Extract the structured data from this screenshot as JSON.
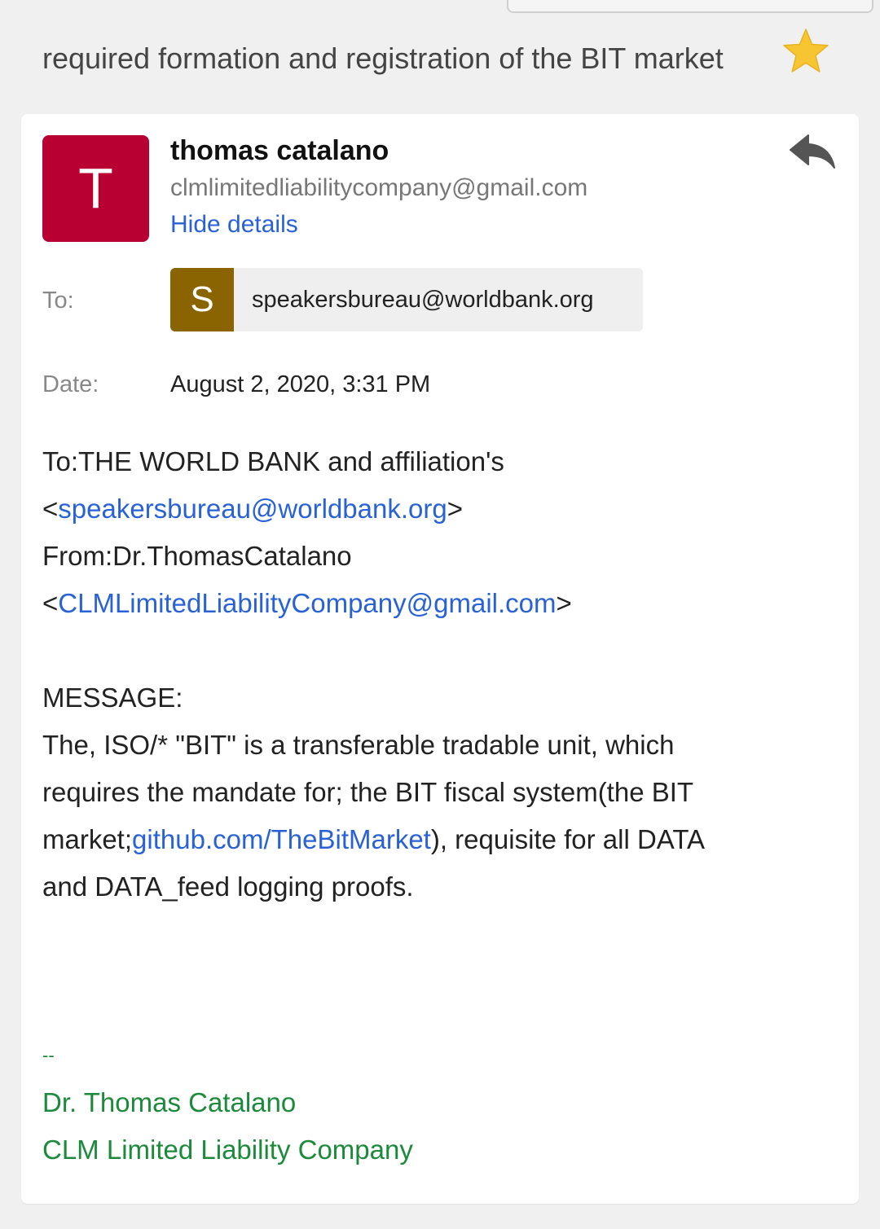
{
  "subject": "required formation and registration of the BIT market",
  "starred": true,
  "sender": {
    "initial": "T",
    "name": "thomas catalano",
    "email": "clmlimitedliabilitycompany@gmail.com",
    "hide_details": "Hide details",
    "avatar_color": "#b80032"
  },
  "recipients": {
    "to_label": "To:",
    "chip_initial": "S",
    "chip_email": "speakersbureau@worldbank.org",
    "chip_color": "#8a6400"
  },
  "date": {
    "label": "Date:",
    "value": "August 2, 2020, 3:31 PM"
  },
  "body": {
    "line1": "To:THE WORLD BANK and affiliation's",
    "lt1": "<",
    "link1": "speakersbureau@worldbank.org",
    "gt1": ">",
    "line3": "From:Dr.ThomasCatalano",
    "lt2": "<",
    "link2": "CLMLimitedLiabilityCompany@gmail.com",
    "gt2": ">",
    "message_label": "MESSAGE:",
    "para1": "The, ISO/* \"BIT\" is a transferable tradable unit, which",
    "para2": "requires the mandate for; the BIT fiscal system(the BIT",
    "para3_pre": "market;",
    "para3_link": "github.com/TheBitMarket",
    "para3_post": "), requisite for all DATA",
    "para4": "and DATA_feed logging proofs."
  },
  "signature": {
    "separator": "--",
    "name": "Dr. Thomas Catalano",
    "company": "CLM Limited Liability Company"
  },
  "colors": {
    "link": "#2962d6",
    "signature": "#1b8a3a",
    "star": "#f7c531"
  }
}
